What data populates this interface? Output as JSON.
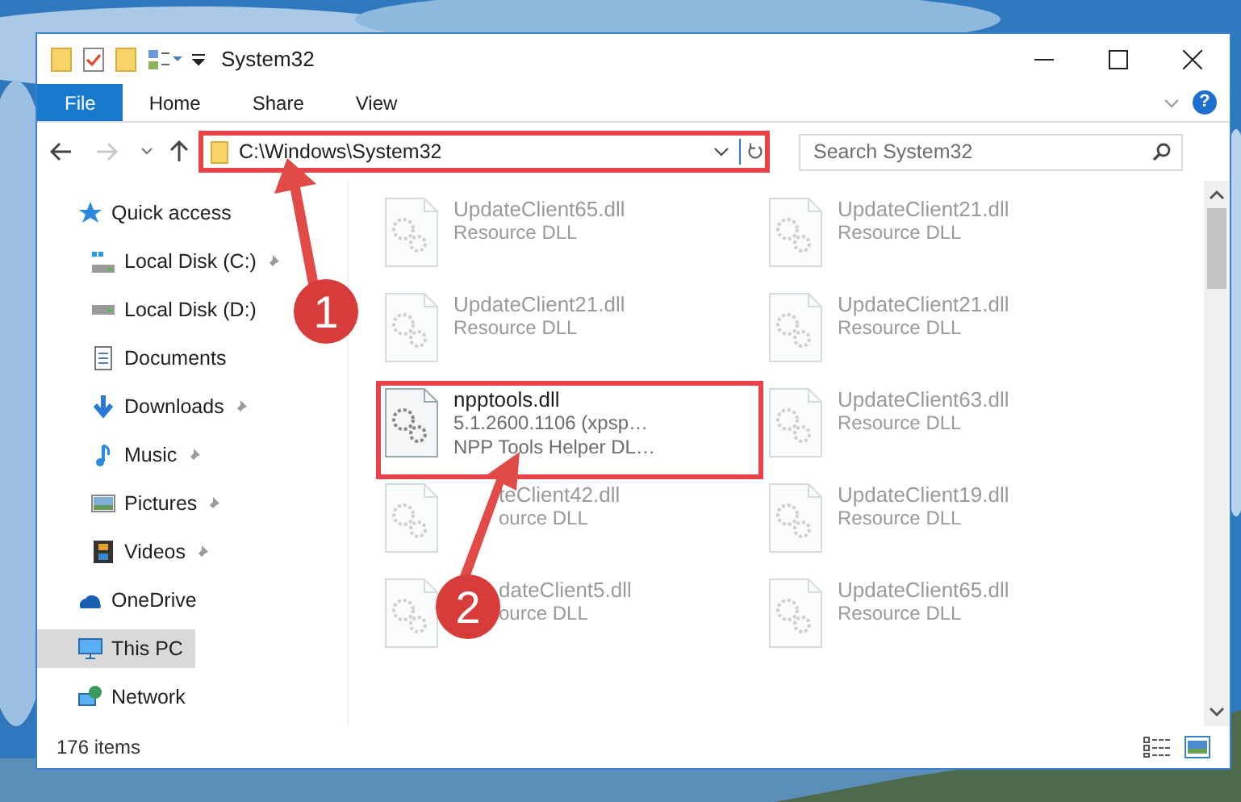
{
  "window": {
    "title": "System32"
  },
  "ribbon_tabs": [
    {
      "label": "File",
      "kind": "file"
    },
    {
      "label": "Home",
      "kind": "tab"
    },
    {
      "label": "Share",
      "kind": "tab"
    },
    {
      "label": "View",
      "kind": "tab"
    }
  ],
  "help_button": {
    "label": "?"
  },
  "address_bar": {
    "path": "C:\\Windows\\System32",
    "highlighted": true
  },
  "search": {
    "placeholder": "Search System32"
  },
  "nav_items": [
    {
      "label": "Quick access",
      "kind": "star",
      "pinned": false,
      "selected": false,
      "children": [
        {
          "label": "Local Disk (C:)",
          "kind": "system-drive",
          "pinned": true,
          "selected": false
        },
        {
          "label": "Local Disk (D:)",
          "kind": "drive",
          "pinned": false,
          "selected": false
        },
        {
          "label": "Documents",
          "kind": "documents",
          "pinned": false,
          "selected": false
        },
        {
          "label": "Downloads",
          "kind": "downloads",
          "pinned": true,
          "selected": false
        },
        {
          "label": "Music",
          "kind": "music",
          "pinned": true,
          "selected": false
        },
        {
          "label": "Pictures",
          "kind": "pictures",
          "pinned": true,
          "selected": false
        },
        {
          "label": "Videos",
          "kind": "videos",
          "pinned": true,
          "selected": false
        }
      ]
    },
    {
      "label": "OneDrive",
      "kind": "cloud",
      "pinned": false,
      "selected": false
    },
    {
      "label": "This PC",
      "kind": "computer",
      "pinned": false,
      "selected": true
    },
    {
      "label": "Network",
      "kind": "network",
      "pinned": false,
      "selected": false
    }
  ],
  "files": [
    {
      "name": "UpdateClient65.dll",
      "details": [
        "Resource DLL"
      ],
      "faded": true,
      "highlighted": false,
      "covered": false
    },
    {
      "name": "UpdateClient21.dll",
      "details": [
        "Resource DLL"
      ],
      "faded": true,
      "highlighted": false,
      "covered": false
    },
    {
      "name": "UpdateClient21.dll",
      "details": [
        "Resource DLL"
      ],
      "faded": true,
      "highlighted": false,
      "covered": false
    },
    {
      "name": "UpdateClient21.dll",
      "details": [
        "Resource DLL"
      ],
      "faded": true,
      "highlighted": false,
      "covered": false
    },
    {
      "name": "npptools.dll",
      "details": [
        "5.1.2600.1106 (xpsp…",
        "NPP Tools Helper DL…"
      ],
      "faded": false,
      "highlighted": true,
      "covered": false
    },
    {
      "name": "UpdateClient63.dll",
      "details": [
        "Resource DLL"
      ],
      "faded": true,
      "highlighted": false,
      "covered": false
    },
    {
      "name": "teClient42.dll",
      "details": [
        "ource DLL"
      ],
      "faded": true,
      "highlighted": false,
      "covered": true
    },
    {
      "name": "UpdateClient19.dll",
      "details": [
        "Resource DLL"
      ],
      "faded": true,
      "highlighted": false,
      "covered": false
    },
    {
      "name": "dateClient5.dll",
      "details": [
        "ource DLL"
      ],
      "faded": true,
      "highlighted": false,
      "covered": true
    },
    {
      "name": "UpdateClient65.dll",
      "details": [
        "Resource DLL"
      ],
      "faded": true,
      "highlighted": false,
      "covered": false
    }
  ],
  "status_bar": {
    "item_count": "176 items"
  },
  "callouts": [
    {
      "number": "1"
    },
    {
      "number": "2"
    }
  ]
}
